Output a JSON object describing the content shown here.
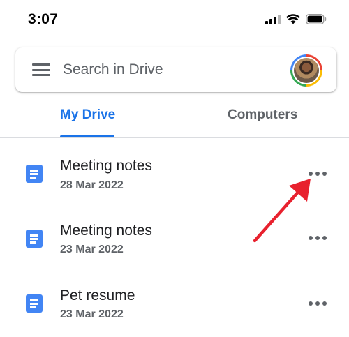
{
  "status_bar": {
    "time": "3:07",
    "icons": [
      "cellular-signal-icon",
      "wifi-icon",
      "battery-icon"
    ]
  },
  "search": {
    "placeholder": "Search in Drive",
    "menu_icon": "hamburger-menu-icon",
    "avatar": "account-avatar"
  },
  "tabs": [
    {
      "label": "My Drive",
      "active": true
    },
    {
      "label": "Computers",
      "active": false
    }
  ],
  "files": [
    {
      "name": "Meeting notes",
      "date": "28 Mar 2022",
      "icon": "google-docs-icon"
    },
    {
      "name": "Meeting notes",
      "date": "23 Mar 2022",
      "icon": "google-docs-icon"
    },
    {
      "name": "Pet resume",
      "date": "23 Mar 2022",
      "icon": "google-docs-icon"
    }
  ],
  "colors": {
    "accent": "#1a73e8",
    "doc_blue": "#4285f4",
    "annotation_arrow": "#e8212e",
    "text_secondary": "#5f6368"
  }
}
